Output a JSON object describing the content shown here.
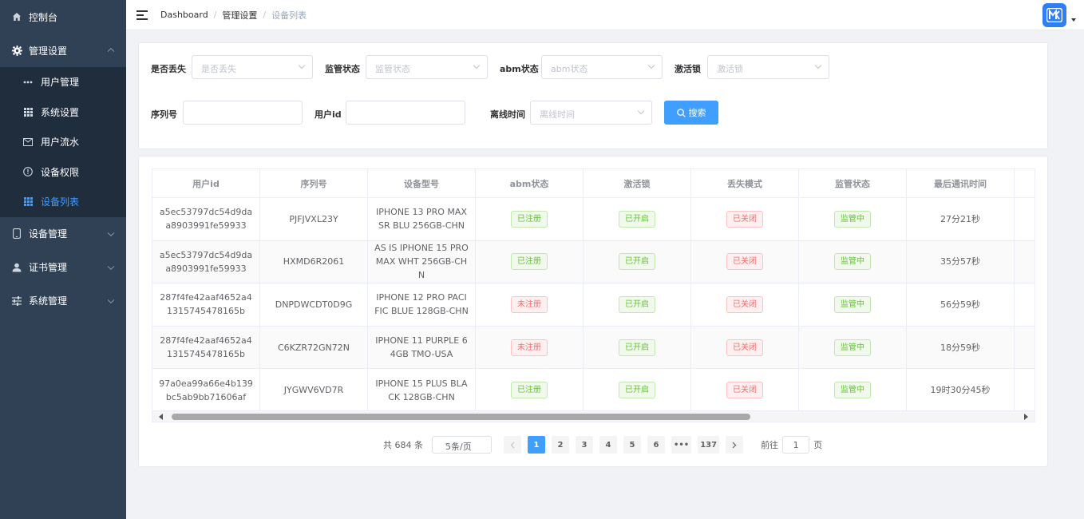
{
  "sidebar": {
    "items": [
      {
        "label": "控制台",
        "icon": "home-icon"
      },
      {
        "label": "管理设置",
        "icon": "gear-icon",
        "expanded": true
      },
      {
        "label": "设备管理",
        "icon": "phone-icon"
      },
      {
        "label": "证书管理",
        "icon": "user-icon"
      },
      {
        "label": "系统管理",
        "icon": "sliders-icon"
      }
    ],
    "sub_items": [
      {
        "label": "用户管理",
        "icon": "dots-icon"
      },
      {
        "label": "系统设置",
        "icon": "grid-icon"
      },
      {
        "label": "用户流水",
        "icon": "mail-icon"
      },
      {
        "label": "设备权限",
        "icon": "info-icon"
      },
      {
        "label": "设备列表",
        "icon": "grid-icon",
        "active": true
      }
    ]
  },
  "header": {
    "breadcrumb": [
      "Dashboard",
      "管理设置",
      "设备列表"
    ],
    "separator": "/",
    "avatar_color": "#2f7ff4"
  },
  "filters": {
    "lost": {
      "label": "是否丢失",
      "placeholder": "是否丢失"
    },
    "supervise": {
      "label": "监管状态",
      "placeholder": "监管状态"
    },
    "abm": {
      "label": "abm状态",
      "placeholder": "abm状态"
    },
    "activation": {
      "label": "激活锁",
      "placeholder": "激活锁"
    },
    "serial": {
      "label": "序列号",
      "value": ""
    },
    "user_id": {
      "label": "用户id",
      "value": ""
    },
    "offline": {
      "label": "离线时间",
      "placeholder": "离线时间"
    },
    "search_label": "搜索"
  },
  "table": {
    "columns": [
      "用户id",
      "序列号",
      "设备型号",
      "abm状态",
      "激活锁",
      "丢失模式",
      "监管状态",
      "最后通讯时间"
    ],
    "rows": [
      {
        "user_id": "a5ec53797dc54d9daa8903991fe59933",
        "serial": "PJFJVXL23Y",
        "model": "IPHONE 13 PRO MAX SR BLU 256GB-CHN",
        "abm": "已注册",
        "abm_color": "green",
        "lock": "已开启",
        "lost": "已关闭",
        "supervise": "监管中",
        "last": "27分21秒"
      },
      {
        "user_id": "a5ec53797dc54d9daa8903991fe59933",
        "serial": "HXMD6R2061",
        "model": "AS IS IPHONE 15 PRO MAX WHT 256GB-CHN",
        "abm": "已注册",
        "abm_color": "green",
        "lock": "已开启",
        "lost": "已关闭",
        "supervise": "监管中",
        "last": "35分57秒"
      },
      {
        "user_id": "287f4fe42aaf4652a41315745478165b",
        "serial": "DNPDWCDT0D9G",
        "model": "IPHONE 12 PRO PACIFIC BLUE 128GB-CHN",
        "abm": "未注册",
        "abm_color": "red",
        "lock": "已开启",
        "lost": "已关闭",
        "supervise": "监管中",
        "last": "56分59秒"
      },
      {
        "user_id": "287f4fe42aaf4652a41315745478165b",
        "serial": "C6KZR72GN72N",
        "model": "IPHONE 11 PURPLE 64GB TMO-USA",
        "abm": "未注册",
        "abm_color": "red",
        "lock": "已开启",
        "lost": "已关闭",
        "supervise": "监管中",
        "last": "18分59秒"
      },
      {
        "user_id": "97a0ea99a66e4b139bc5ab9bb71606af",
        "serial": "JYGWV6VD7R",
        "model": "IPHONE 15 PLUS BLACK 128GB-CHN",
        "abm": "已注册",
        "abm_color": "green",
        "lock": "已开启",
        "lost": "已关闭",
        "supervise": "监管中",
        "last": "19时30分45秒"
      }
    ]
  },
  "pagination": {
    "total": "共 684 条",
    "page_size": "5条/页",
    "pages": [
      "1",
      "2",
      "3",
      "4",
      "5",
      "6",
      "•••",
      "137"
    ],
    "current": "1",
    "goto_label": "前往",
    "goto_value": "1",
    "goto_suffix": "页"
  },
  "colors": {
    "sidebar_bg": "#304156",
    "submenu_bg": "#1f2d3d",
    "accent": "#409eff",
    "success": "#67c23a",
    "danger": "#f56c6c"
  }
}
